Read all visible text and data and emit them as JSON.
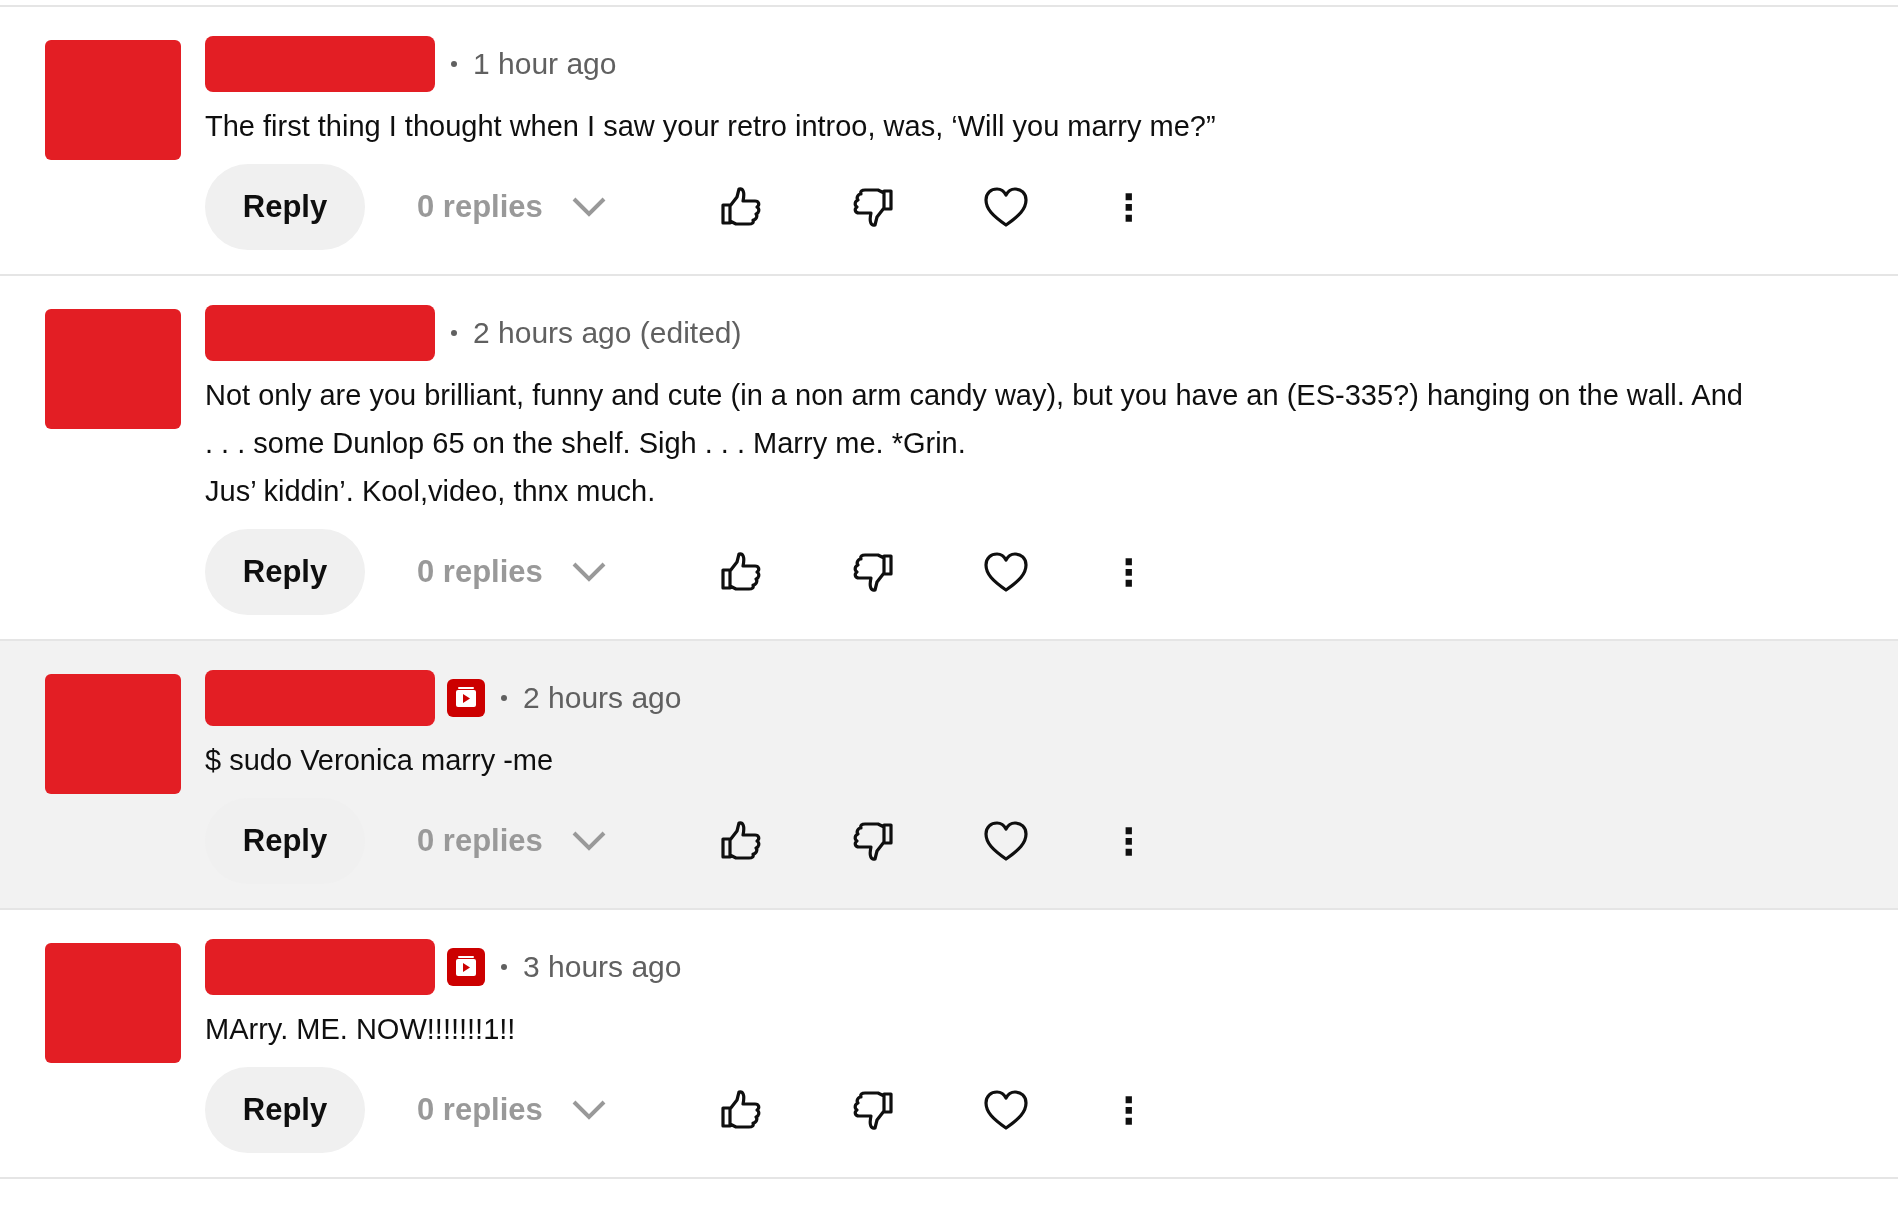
{
  "comments": [
    {
      "time": "1 hour ago",
      "badge": false,
      "highlighted": false,
      "lines": [
        "The first thing I thought when I saw your retro introo, was, ‘Will you marry me?”"
      ],
      "reply": "Reply",
      "replies": "0 replies",
      "menu": "⋮"
    },
    {
      "time": "2 hours ago (edited)",
      "badge": false,
      "highlighted": false,
      "lines": [
        "Not only are you brilliant, funny and cute (in a non arm candy way), but you have an (ES-335?) hanging on the wall. And",
        ". . . some Dunlop 65 on the shelf. Sigh . . . Marry me.  *Grin.",
        "Jus’ kiddin’. Kool,video, thnx much."
      ],
      "reply": "Reply",
      "replies": "0 replies",
      "menu": "⋮"
    },
    {
      "time": "2 hours ago",
      "badge": true,
      "highlighted": true,
      "lines": [
        "$ sudo Veronica marry -me"
      ],
      "reply": "Reply",
      "replies": "0 replies",
      "menu": "⋮"
    },
    {
      "time": "3 hours ago",
      "badge": true,
      "highlighted": false,
      "lines": [
        "MArry. ME. NOW!!!!!!!1!!"
      ],
      "reply": "Reply",
      "replies": "0 replies",
      "menu": "⋮"
    }
  ]
}
